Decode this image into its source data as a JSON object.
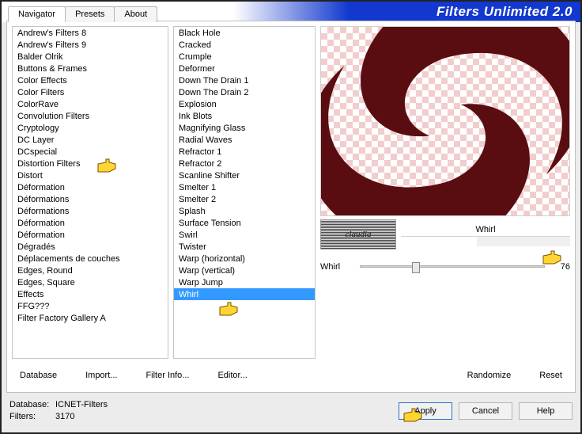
{
  "title": "Filters Unlimited 2.0",
  "tabs": [
    "Navigator",
    "Presets",
    "About"
  ],
  "active_tab": 0,
  "categories": [
    "Andrew's Filters 8",
    "Andrew's Filters 9",
    "Balder Olrik",
    "Buttons & Frames",
    "Color Effects",
    "Color Filters",
    "ColorRave",
    "Convolution Filters",
    "Cryptology",
    "DC Layer",
    "DCspecial",
    "Distortion Filters",
    "Distort",
    "Déformation",
    "Déformations",
    "Déformations",
    "Déformation",
    "Déformation",
    "Dégradés",
    "Déplacements de couches",
    "Edges, Round",
    "Edges, Square",
    "Effects",
    "FFG???",
    "Filter Factory Gallery A"
  ],
  "selected_category": "Distortion Filters",
  "filters": [
    "Black Hole",
    "Cracked",
    "Crumple",
    "Deformer",
    "Down The Drain 1",
    "Down The Drain 2",
    "Explosion",
    "Ink Blots",
    "Magnifying Glass",
    "Radial Waves",
    "Refractor 1",
    "Refractor 2",
    "Scanline Shifter",
    "Smelter 1",
    "Smelter 2",
    "Splash",
    "Surface Tension",
    "Swirl",
    "Twister",
    "Warp (horizontal)",
    "Warp (vertical)",
    "Warp Jump",
    "Whirl"
  ],
  "selected_filter": "Whirl",
  "effect_name": "Whirl",
  "badge_text": "claudia",
  "param": {
    "label": "Whirl",
    "value": 76,
    "min": 0,
    "max": 255
  },
  "col_buttons": {
    "database": "Database",
    "import": "Import...",
    "filter_info": "Filter Info...",
    "editor": "Editor...",
    "randomize": "Randomize",
    "reset": "Reset"
  },
  "footer": {
    "db_label": "Database:",
    "db_value": "ICNET-Filters",
    "filters_label": "Filters:",
    "filters_value": "3170",
    "apply": "Apply",
    "cancel": "Cancel",
    "help": "Help"
  }
}
